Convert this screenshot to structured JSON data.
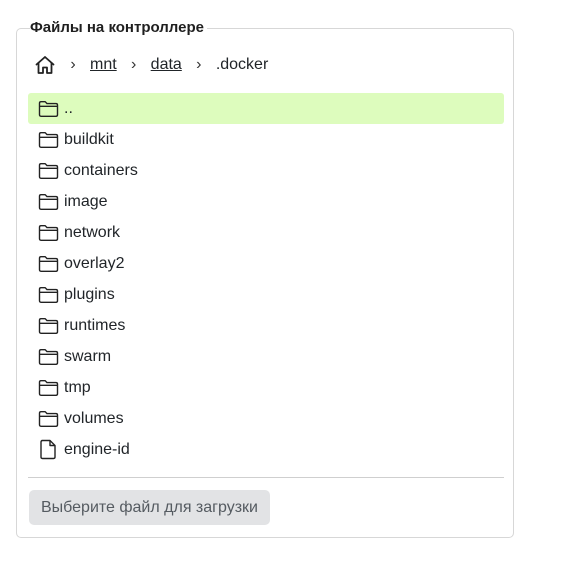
{
  "panel": {
    "title": "Файлы на контроллере"
  },
  "breadcrumb": {
    "home_icon": "home-icon",
    "separator": "›",
    "links": [
      "mnt",
      "data"
    ],
    "current": ".docker"
  },
  "files": [
    {
      "name": "..",
      "type": "folder",
      "highlighted": true
    },
    {
      "name": "buildkit",
      "type": "folder"
    },
    {
      "name": "containers",
      "type": "folder"
    },
    {
      "name": "image",
      "type": "folder"
    },
    {
      "name": "network",
      "type": "folder"
    },
    {
      "name": "overlay2",
      "type": "folder"
    },
    {
      "name": "plugins",
      "type": "folder"
    },
    {
      "name": "runtimes",
      "type": "folder"
    },
    {
      "name": "swarm",
      "type": "folder"
    },
    {
      "name": "tmp",
      "type": "folder"
    },
    {
      "name": "volumes",
      "type": "folder"
    },
    {
      "name": "engine-id",
      "type": "file"
    }
  ],
  "upload": {
    "label": "Выберите файл для загрузки"
  },
  "colors": {
    "highlight": "#ddfcbd",
    "button_bg": "#e2e3e5",
    "border": "#d7d7d7"
  }
}
